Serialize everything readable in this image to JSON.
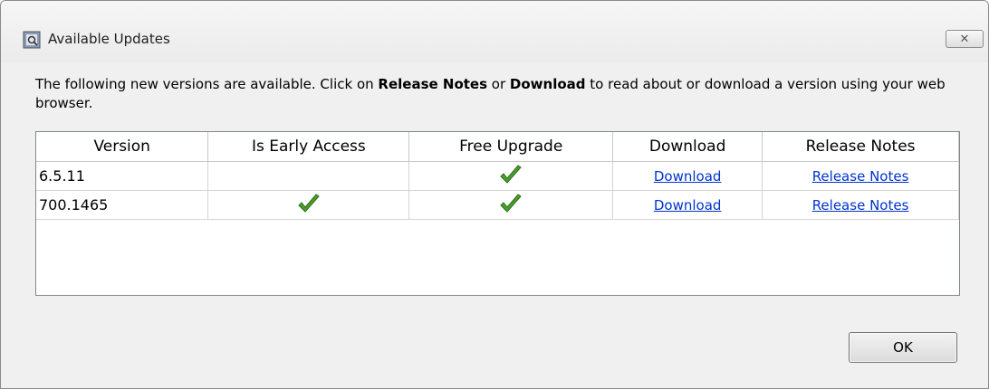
{
  "window": {
    "title": "Available Updates",
    "close_label": "✕"
  },
  "description": {
    "part1": "The following new versions are available. Click on ",
    "bold1": "Release Notes",
    "part2": " or ",
    "bold2": "Download",
    "part3": " to read about or download a version using your web browser."
  },
  "table": {
    "headers": [
      "Version",
      "Is Early Access",
      "Free Upgrade",
      "Download",
      "Release Notes"
    ],
    "rows": [
      {
        "version": "6.5.11",
        "early_access": false,
        "free_upgrade": true,
        "download": "Download",
        "release_notes": "Release Notes"
      },
      {
        "version": "700.1465",
        "early_access": true,
        "free_upgrade": true,
        "download": "Download",
        "release_notes": "Release Notes"
      }
    ]
  },
  "buttons": {
    "ok": "OK"
  },
  "colors": {
    "check": "#4aa02c",
    "link": "#0033cc"
  }
}
